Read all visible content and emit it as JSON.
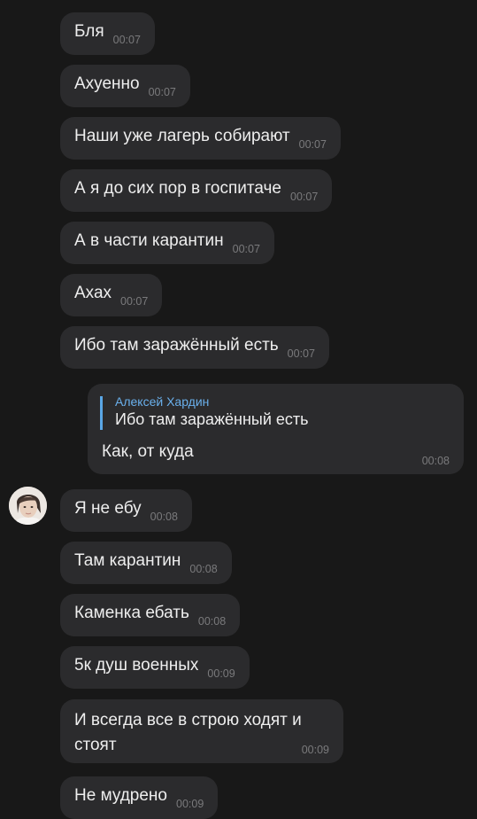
{
  "messages": [
    {
      "text": "Бля",
      "time": "00:07"
    },
    {
      "text": "Ахуенно",
      "time": "00:07"
    },
    {
      "text": "Наши уже лагерь собирают",
      "time": "00:07"
    },
    {
      "text": "А я до сих пор в госпитаче",
      "time": "00:07"
    },
    {
      "text": "А в части карантин",
      "time": "00:07"
    },
    {
      "text": "Ахах",
      "time": "00:07"
    },
    {
      "text": "Ибо там заражённый есть",
      "time": "00:07"
    },
    {
      "text": "Я не ебу",
      "time": "00:08"
    },
    {
      "text": "Там карантин",
      "time": "00:08"
    },
    {
      "text": "Каменка ебать",
      "time": "00:08"
    },
    {
      "text": "5к душ военных",
      "time": "00:09"
    },
    {
      "text": "И всегда все в строю ходят и стоят",
      "time": "00:09"
    },
    {
      "text": "Не мудрено",
      "time": "00:09"
    }
  ],
  "outgoing": {
    "reply_author": "Алексей Хардин",
    "reply_text": "Ибо там заражённый есть",
    "text": "Как, от куда",
    "time": "00:08"
  },
  "colors": {
    "background": "#181818",
    "bubble": "#2b2b2d",
    "reply_accent": "#5aa7e6"
  },
  "icons": {
    "avatar": "user-avatar-photo"
  }
}
